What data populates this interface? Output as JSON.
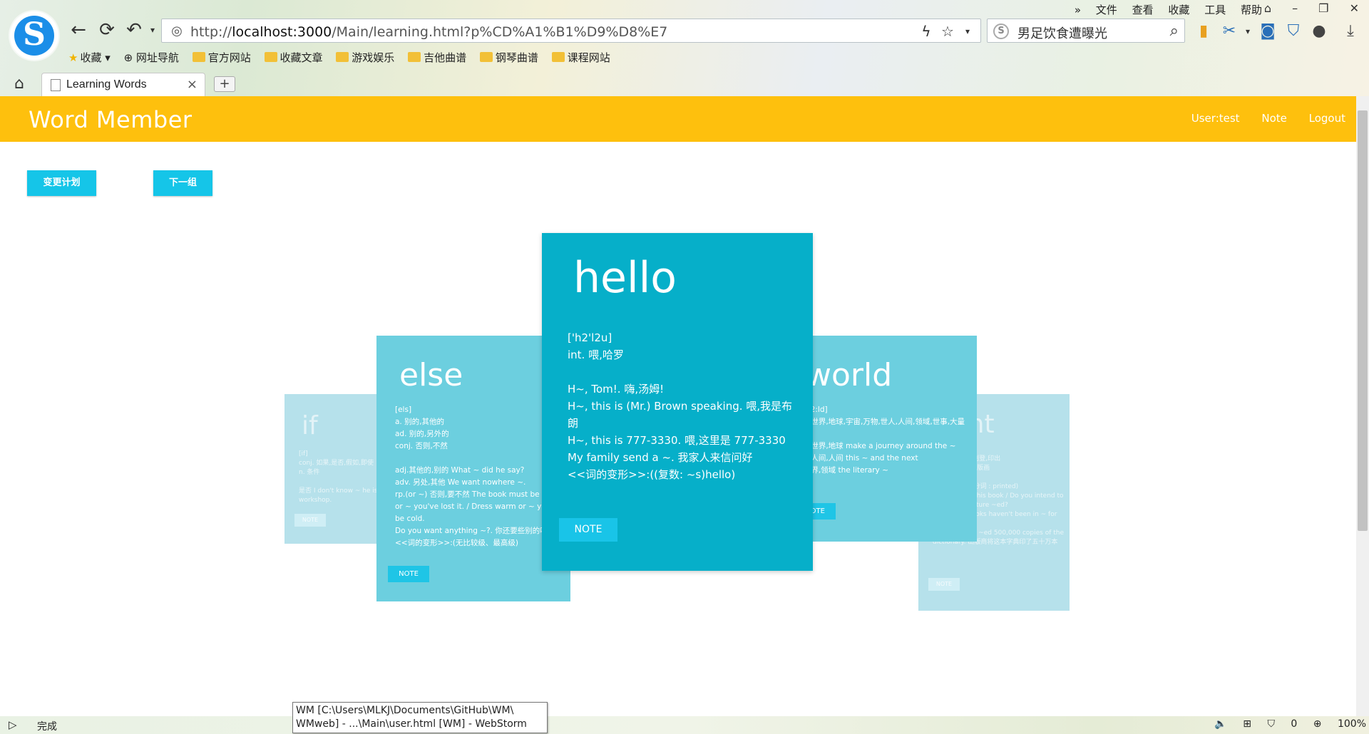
{
  "browser": {
    "url_prefix": "http://",
    "url_host": "localhost:3000",
    "url_path": "/Main/learning.html?p%CD%A1%B1%D9%D8%E7",
    "search_query": "男足饮食遭曝光",
    "menu": [
      "文件",
      "查看",
      "收藏",
      "工具",
      "帮助"
    ],
    "bookmarks": [
      {
        "label": "收藏",
        "icon": "star-icon"
      },
      {
        "label": "网址导航",
        "icon": "globe-icon"
      },
      {
        "label": "官方网站",
        "icon": "folder-icon"
      },
      {
        "label": "收藏文章",
        "icon": "folder-icon"
      },
      {
        "label": "游戏娱乐",
        "icon": "folder-icon"
      },
      {
        "label": "吉他曲谱",
        "icon": "folder-icon"
      },
      {
        "label": "钢琴曲谱",
        "icon": "folder-icon"
      },
      {
        "label": "课程网站",
        "icon": "folder-icon"
      }
    ],
    "tab_title": "Learning Words",
    "status_done": "完成",
    "status_right": {
      "badge": "0",
      "zoom": "100%"
    },
    "tooltip_line1": "WM [C:\\Users\\MLKJ\\Documents\\GitHub\\WM\\",
    "tooltip_line2": "WMweb] - ...\\Main\\user.html [WM] - WebStorm"
  },
  "app": {
    "brand": "Word Member",
    "nav": {
      "user": "User:test",
      "note": "Note",
      "logout": "Logout"
    },
    "buttons": {
      "change_plan": "变更计划",
      "next_group": "下一组"
    },
    "colors": {
      "navbar": "#fec00d",
      "card_active": "#06afc9",
      "card_mid": "#6ccfdf",
      "card_far": "#b6e1eb",
      "button": "#15c5e8"
    }
  },
  "cards": {
    "hello": {
      "word": "hello",
      "body": "['h2'l2u]\nint. 喂,哈罗\n\nH~, Tom!. 嗨,汤姆!\nH~, this is (Mr.) Brown speaking. 喂,我是布朗\nH~, this is 777-3330. 喂,这里是 777-3330\nMy family send a ~. 我家人来信问好\n<<词的变形>>:((复数: ~s)hello)",
      "note": "NOTE"
    },
    "else": {
      "word": "else",
      "body": "[els]\na. 别的,其他的\nad. 别的,另外的\nconj. 否则,不然\n\nadj.其他的,别的 What ~ did he say?\nadv. 另处,其他 We want nowhere ~.\nrp.(or ~) 否则,要不然 The book must be here, or ~ you've lost it. / Dress warm or ~ you will be cold.\nDo you want anything ~?. 你还要些别的吗?\n<<词的变形>>:(无比较级、最高级)",
      "note": "NOTE"
    },
    "world": {
      "word": "world",
      "body": "[w2:ld]\nn. 世界,地球,宇宙,万物,世人,人间,领域,世事,大量\n\nn. 世界,地球 make a journey around the ~\nn. 人间,人间 this ~ and the next\nn. 界,领域 the literary ~",
      "note": "NOTE"
    },
    "if": {
      "word": "if",
      "body": "[if]\nconj. 如果,是否,假如,即使\nn. 条件\n\n是否 I don't know ~ he is coming to the workshop.",
      "note": "NOTE"
    },
    "print": {
      "word": "print",
      "body": "[print]\nvt. 印刷,出版,刊登,印出\nn. 印刷,印刷品,版画\n\n(过去式、过去分词 : printed)\nvt. 印刷,出版 This book / Do you intend to have your lecture ~ed?\nn. 刊印 His books haven't been in ~ for twenty years.\nThe publisher ~ed 500,000 copies of the dictionary. 出版商将这本字典印了五十万本",
      "note": "NOTE"
    }
  }
}
